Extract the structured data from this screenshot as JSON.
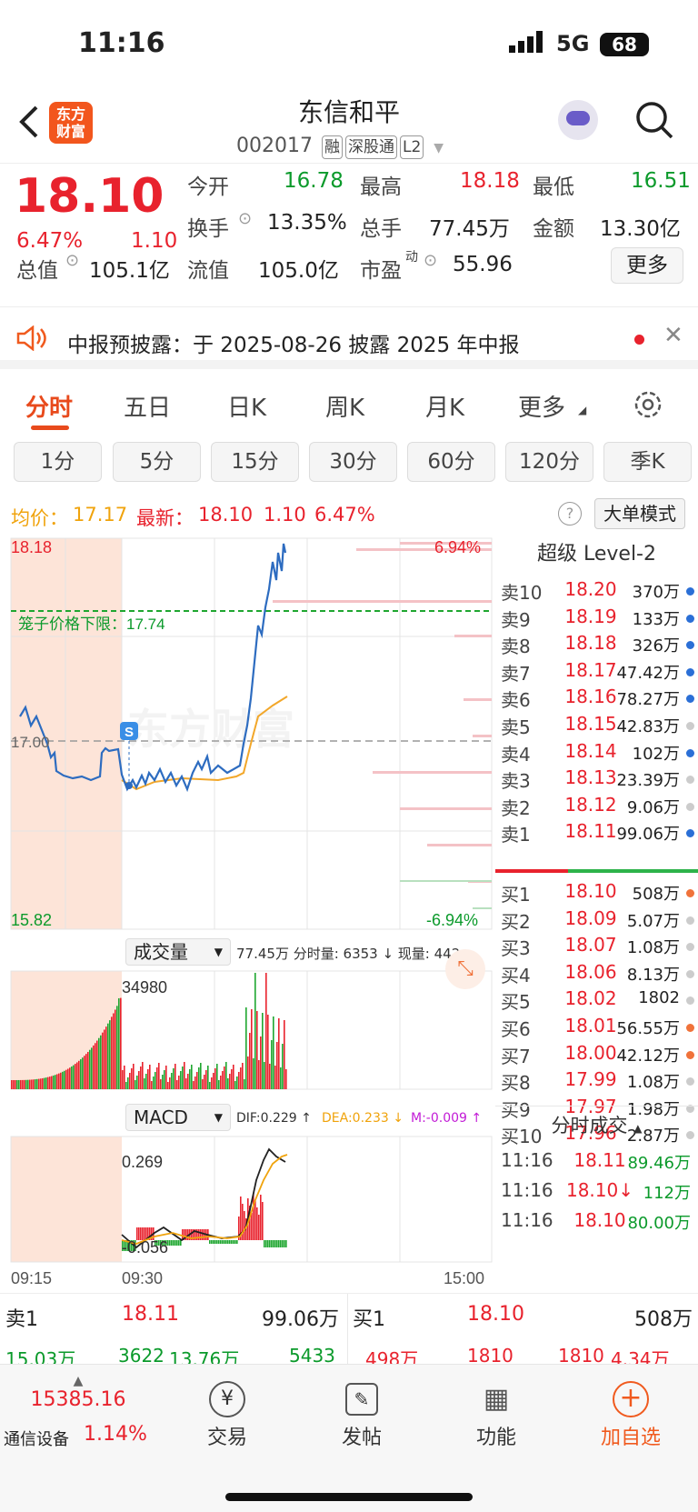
{
  "status": {
    "time": "11:16",
    "network": "5G",
    "battery": "68"
  },
  "header": {
    "stock_name": "东信和平",
    "code": "002017",
    "tags": [
      "融",
      "深股通",
      "L2"
    ]
  },
  "quote": {
    "price": "18.10",
    "pct": "6.47%",
    "chg": "1.10",
    "open_label": "今开",
    "open": "16.78",
    "high_label": "最高",
    "high": "18.18",
    "low_label": "最低",
    "low": "16.51",
    "turnover_label": "换手",
    "turnover": "13.35%",
    "volume_label": "总手",
    "volume": "77.45万",
    "amount_label": "金额",
    "amount": "13.30亿",
    "mcap_label": "总值",
    "mcap": "105.1亿",
    "float_label": "流值",
    "float": "105.0亿",
    "pe_label": "市盈",
    "pe_sup": "动",
    "pe": "55.96",
    "more": "更多"
  },
  "notice": {
    "text": "中报预披露：于 2025-08-26 披露 2025 年中报"
  },
  "tabs": [
    "分时",
    "五日",
    "日K",
    "周K",
    "月K",
    "更多"
  ],
  "ktabs": [
    "1分",
    "5分",
    "15分",
    "30分",
    "60分",
    "120分",
    "季K"
  ],
  "info": {
    "avg_label": "均价：",
    "avg": "17.17",
    "latest_label": "最新：",
    "latest": "18.10",
    "chg": "1.10",
    "pct": "6.47%",
    "mode": "大单模式"
  },
  "chart": {
    "top_price": "18.18",
    "bottom_price": "15.82",
    "top_pct": "6.94%",
    "bottom_pct": "-6.94%",
    "mid_price": "17.00",
    "limit_label": "笼子价格下限：17.74",
    "watermark": "东方财富",
    "vol_label": "成交量",
    "vol_info": "77.45万 分时量: 6353 ↓ 现量: 442",
    "vol_max": "34980",
    "macd_label": "MACD",
    "dif": "DIF:0.229 ↑",
    "dea": "DEA:0.233 ↓",
    "m": "M:-0.009 ↑",
    "macd_top": "0.269",
    "macd_bot": "-0.056",
    "t_start": "09:15",
    "t_mid": "09:30",
    "t_end": "15:00"
  },
  "orderbook": {
    "title": "超级 Level-2",
    "asks": [
      {
        "l": "卖10",
        "p": "18.20",
        "v": "370万"
      },
      {
        "l": "卖9",
        "p": "18.19",
        "v": "133万"
      },
      {
        "l": "卖8",
        "p": "18.18",
        "v": "326万"
      },
      {
        "l": "卖7",
        "p": "18.17",
        "v": "47.42万"
      },
      {
        "l": "卖6",
        "p": "18.16",
        "v": "78.27万"
      },
      {
        "l": "卖5",
        "p": "18.15",
        "v": "42.83万"
      },
      {
        "l": "卖4",
        "p": "18.14",
        "v": "102万"
      },
      {
        "l": "卖3",
        "p": "18.13",
        "v": "23.39万"
      },
      {
        "l": "卖2",
        "p": "18.12",
        "v": "9.06万"
      },
      {
        "l": "卖1",
        "p": "18.11",
        "v": "99.06万"
      }
    ],
    "bids": [
      {
        "l": "买1",
        "p": "18.10",
        "v": "508万"
      },
      {
        "l": "买2",
        "p": "18.09",
        "v": "5.07万"
      },
      {
        "l": "买3",
        "p": "18.07",
        "v": "1.08万"
      },
      {
        "l": "买4",
        "p": "18.06",
        "v": "8.13万"
      },
      {
        "l": "买5",
        "p": "18.02",
        "v": "1802"
      },
      {
        "l": "买6",
        "p": "18.01",
        "v": "56.55万"
      },
      {
        "l": "买7",
        "p": "18.00",
        "v": "42.12万"
      },
      {
        "l": "买8",
        "p": "17.99",
        "v": "1.08万"
      },
      {
        "l": "买9",
        "p": "17.97",
        "v": "1.98万"
      },
      {
        "l": "买10",
        "p": "17.96",
        "v": "2.87万"
      }
    ],
    "trades_title": "分时成交",
    "trades": [
      {
        "t": "11:16",
        "p": "18.11",
        "v": "89.46万"
      },
      {
        "t": "11:16",
        "p": "18.10↓",
        "v": "112万"
      },
      {
        "t": "11:16",
        "p": "18.10",
        "v": "80.00万"
      }
    ]
  },
  "bottom": {
    "sell_label": "卖1",
    "sell_p": "18.11",
    "sell_v": "99.06万",
    "buy_label": "买1",
    "buy_p": "18.10",
    "buy_v": "508万",
    "r2a": "15.03万",
    "r2b": "3622",
    "r2c": "13.76万",
    "r2d": "5433",
    "r2e": "498万",
    "r2f": "1810",
    "r2g": "1810",
    "r2h": "4.34万"
  },
  "tabbar": {
    "index_value": "15385.16",
    "index_name": "通信设备",
    "index_pct": "1.14%",
    "trade": "交易",
    "post": "发帖",
    "func": "功能",
    "add": "加自选"
  }
}
